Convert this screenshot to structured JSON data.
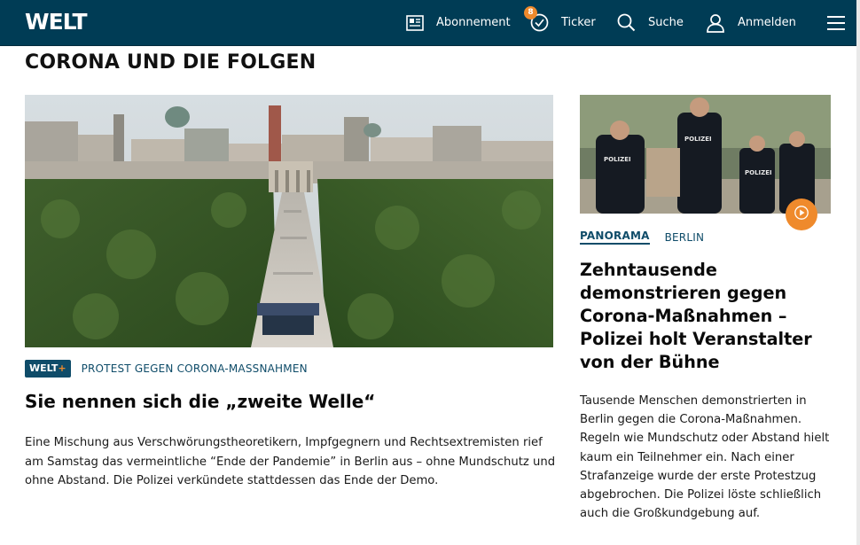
{
  "header": {
    "logo": "WELT",
    "nav": [
      {
        "label": "Abonnement",
        "icon": "newspaper-icon"
      },
      {
        "label": "Ticker",
        "icon": "ticker-check-icon",
        "badge": "8"
      },
      {
        "label": "Suche",
        "icon": "search-icon"
      },
      {
        "label": "Anmelden",
        "icon": "user-icon"
      }
    ],
    "menu_icon": "hamburger-menu-icon"
  },
  "section": {
    "title": "CORONA UND DIE FOLGEN"
  },
  "main_teaser": {
    "image_alt": "Aerial view of crowd on Straße des 17. Juni toward Brandenburg Gate, Berlin",
    "badge": {
      "text": "WELT",
      "plus": "+"
    },
    "kicker": "PROTEST GEGEN CORONA-MASSNAHMEN",
    "headline": "Sie nennen sich die „zweite Welle“",
    "text": "Eine Mischung aus Verschwörungstheoretikern, Impfgegnern und Rechtsextremisten rief am Samstag das vermeintliche “Ende der Pandemie” in Berlin aus – ohne Mundschutz und ohne Abstand. Die Polizei verkündete stattdessen das Ende der Demo."
  },
  "side_teaser": {
    "image_alt": "Police officers carrying a demonstrator",
    "tags": [
      "PANORAMA",
      "BERLIN"
    ],
    "headline": "Zehntausende demonstrieren gegen Corona-Maßnahmen – Polizei holt Veranstalter von der Bühne",
    "text": "Tausende Menschen demonstrierten in Berlin gegen die Corona-Maßnahmen. Regeln wie Mundschutz oder Abstand hielt kaum ein Teilnehmer ein. Nach einer Strafanzeige wurde der erste Protestzug abgebrochen. Die Polizei löste schließlich auch die Großkundgebung auf."
  },
  "colors": {
    "header_bg": "#003c55",
    "accent": "#ef8a2c",
    "link": "#0f4c69"
  }
}
